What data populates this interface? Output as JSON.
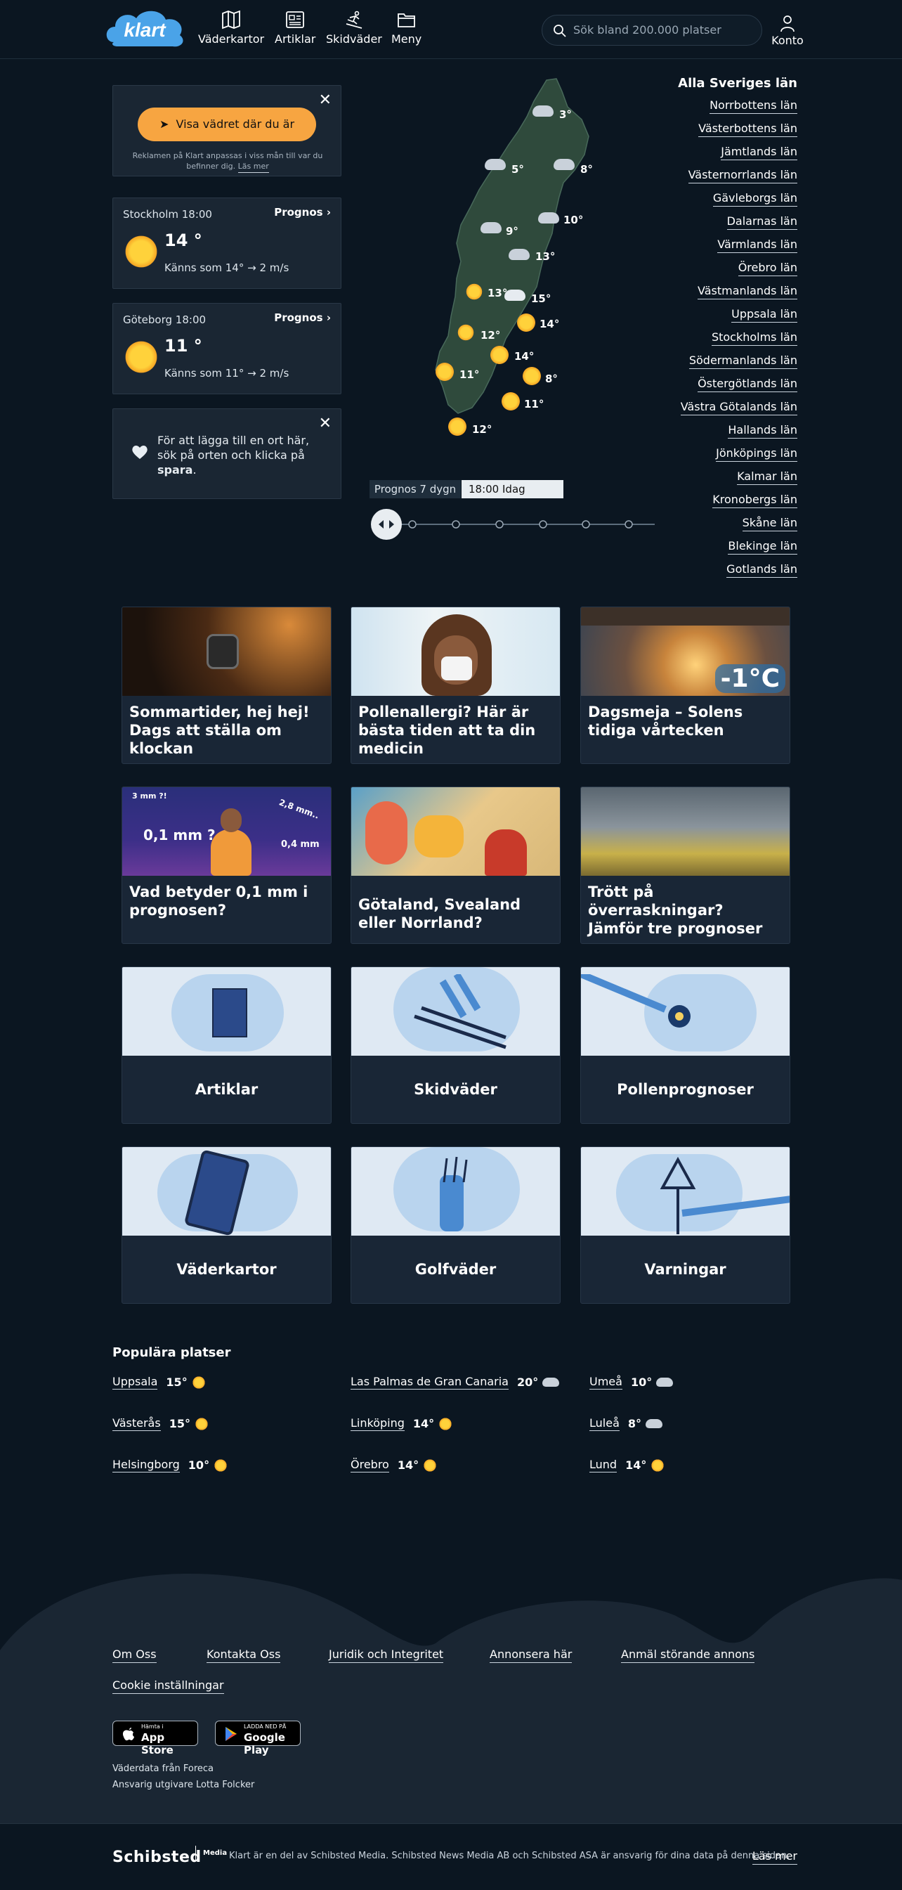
{
  "header": {
    "logo": "klart",
    "nav": [
      {
        "label": "Väderkartor",
        "icon": "map-icon"
      },
      {
        "label": "Artiklar",
        "icon": "newspaper-icon"
      },
      {
        "label": "Skidväder",
        "icon": "skier-icon"
      },
      {
        "label": "Meny",
        "icon": "folder-icon"
      }
    ],
    "search_placeholder": "Sök bland 200.000 platser",
    "account_label": "Konto"
  },
  "location_panel": {
    "button_label": "Visa vädret där du är",
    "ad_note": "Reklamen på Klart anpassas i viss mån till var du befinner dig.",
    "ad_link": "Läs mer"
  },
  "city_cards": [
    {
      "name": "Stockholm 18:00",
      "link": "Prognos",
      "temp": "14 °",
      "feels": "Känns som 14°",
      "wind": "2 m/s"
    },
    {
      "name": "Göteborg 18:00",
      "link": "Prognos",
      "temp": "11 °",
      "feels": "Känns som 11°",
      "wind": "2 m/s"
    }
  ],
  "save_tip": {
    "text": "För att lägga till en ort här, sök på orten och klicka på ",
    "bold": "spara",
    "end": "."
  },
  "map": {
    "temps": [
      "3°",
      "5°",
      "8°",
      "9°",
      "10°",
      "13°",
      "13°",
      "15°",
      "12°",
      "14°",
      "11°",
      "14°",
      "8°",
      "11°",
      "12°"
    ],
    "forecast_label": "Prognos 7 dygn",
    "time_value": "18:00 Idag"
  },
  "lan": {
    "title": "Alla Sveriges län",
    "items": [
      "Norrbottens län",
      "Västerbottens län",
      "Jämtlands län",
      "Västernorrlands län",
      "Gävleborgs län",
      "Dalarnas län",
      "Värmlands län",
      "Örebro län",
      "Västmanlands län",
      "Uppsala län",
      "Stockholms län",
      "Södermanlands län",
      "Östergötlands län",
      "Västra Götalands län",
      "Hallands län",
      "Jönköpings län",
      "Kalmar län",
      "Kronobergs län",
      "Skåne län",
      "Blekinge län",
      "Gotlands län"
    ]
  },
  "articles": [
    {
      "title": "Sommartider, hej hej! Dags att ställa om klockan"
    },
    {
      "title": "Pollenallergi? Här är bästa tiden att ta din medicin"
    },
    {
      "title": "Dagsmeja – Solens tidiga vårtecken",
      "badge": "-1°C"
    },
    {
      "title": "Vad betyder 0,1 mm i prognosen?",
      "labels": [
        "3 mm ?!",
        "0,1 mm ?",
        "2,8 mm..",
        "0,4 mm"
      ]
    },
    {
      "title": "Götaland, Svealand eller Norrland?"
    },
    {
      "title": "Trött på överraskningar? Jämför tre prognoser"
    }
  ],
  "categories": [
    "Artiklar",
    "Skidväder",
    "Pollenprognoser",
    "Väderkartor",
    "Golfväder",
    "Varningar"
  ],
  "popular": {
    "title": "Populära platser",
    "places": [
      {
        "name": "Uppsala",
        "temp": "15°",
        "icon": "sun-icon"
      },
      {
        "name": "Las Palmas de Gran Canaria",
        "temp": "20°",
        "icon": "rain-cloud-icon"
      },
      {
        "name": "Umeå",
        "temp": "10°",
        "icon": "cloud-icon"
      },
      {
        "name": "Västerås",
        "temp": "15°",
        "icon": "sun-cloud-icon"
      },
      {
        "name": "Linköping",
        "temp": "14°",
        "icon": "sun-icon"
      },
      {
        "name": "Luleå",
        "temp": "8°",
        "icon": "cloud-icon"
      },
      {
        "name": "Helsingborg",
        "temp": "10°",
        "icon": "sun-icon"
      },
      {
        "name": "Örebro",
        "temp": "14°",
        "icon": "sun-icon"
      },
      {
        "name": "Lund",
        "temp": "14°",
        "icon": "sun-icon"
      }
    ]
  },
  "footer": {
    "links": [
      "Om Oss",
      "Kontakta Oss",
      "Juridik och Integritet",
      "Annonsera här",
      "Anmäl störande annons"
    ],
    "cookie": "Cookie inställningar",
    "appstore_small": "Hämta i",
    "appstore": "App Store",
    "googleplay_small": "LADDA NED PÅ",
    "googleplay": "Google Play",
    "source": "Väderdata från Foreca",
    "editor": "Ansvarig utgivare Lotta Folcker",
    "brand": "Schibsted",
    "brand_sub": "Media",
    "legal": "Klart är en del av Schibsted Media. Schibsted News Media AB och Schibsted ASA är ansvarig för dina data på denna sidan.",
    "legal_link": "Läs mer"
  }
}
